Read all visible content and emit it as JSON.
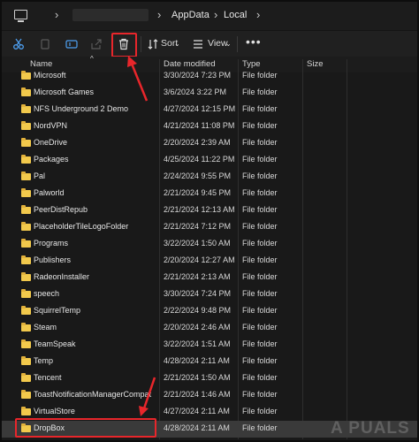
{
  "address_bar": {
    "crumbs": [
      "AppData",
      "Local"
    ]
  },
  "toolbar": {
    "sort_label": "Sort",
    "view_label": "View",
    "more_label": "•••"
  },
  "columns": {
    "name": "Name",
    "date": "Date modified",
    "type": "Type",
    "size": "Size"
  },
  "files": [
    {
      "name": "Microsoft",
      "date": "3/30/2024 7:23 PM",
      "type": "File folder"
    },
    {
      "name": "Microsoft Games",
      "date": "3/6/2024 3:22 PM",
      "type": "File folder"
    },
    {
      "name": "NFS Underground 2 Demo",
      "date": "4/27/2024 12:15 PM",
      "type": "File folder"
    },
    {
      "name": "NordVPN",
      "date": "4/21/2024 11:08 PM",
      "type": "File folder"
    },
    {
      "name": "OneDrive",
      "date": "2/20/2024 2:39 AM",
      "type": "File folder"
    },
    {
      "name": "Packages",
      "date": "4/25/2024 11:22 PM",
      "type": "File folder"
    },
    {
      "name": "Pal",
      "date": "2/24/2024 9:55 PM",
      "type": "File folder"
    },
    {
      "name": "Palworld",
      "date": "2/21/2024 9:45 PM",
      "type": "File folder"
    },
    {
      "name": "PeerDistRepub",
      "date": "2/21/2024 12:13 AM",
      "type": "File folder"
    },
    {
      "name": "PlaceholderTileLogoFolder",
      "date": "2/21/2024 7:12 PM",
      "type": "File folder"
    },
    {
      "name": "Programs",
      "date": "3/22/2024 1:50 AM",
      "type": "File folder"
    },
    {
      "name": "Publishers",
      "date": "2/20/2024 12:27 AM",
      "type": "File folder"
    },
    {
      "name": "RadeonInstaller",
      "date": "2/21/2024 2:13 AM",
      "type": "File folder"
    },
    {
      "name": "speech",
      "date": "3/30/2024 7:24 PM",
      "type": "File folder"
    },
    {
      "name": "SquirrelTemp",
      "date": "2/22/2024 9:48 PM",
      "type": "File folder"
    },
    {
      "name": "Steam",
      "date": "2/20/2024 2:46 AM",
      "type": "File folder"
    },
    {
      "name": "TeamSpeak",
      "date": "3/22/2024 1:51 AM",
      "type": "File folder"
    },
    {
      "name": "Temp",
      "date": "4/28/2024 2:11 AM",
      "type": "File folder"
    },
    {
      "name": "Tencent",
      "date": "2/21/2024 1:50 AM",
      "type": "File folder"
    },
    {
      "name": "ToastNotificationManagerCompat",
      "date": "2/21/2024 1:46 AM",
      "type": "File folder"
    },
    {
      "name": "VirtualStore",
      "date": "4/27/2024 2:11 AM",
      "type": "File folder"
    },
    {
      "name": "DropBox",
      "date": "4/28/2024 2:11 AM",
      "type": "File folder"
    }
  ],
  "watermark": "A  PUALS",
  "colors": {
    "highlight": "#e8262b",
    "folder": "#f2c94c"
  }
}
